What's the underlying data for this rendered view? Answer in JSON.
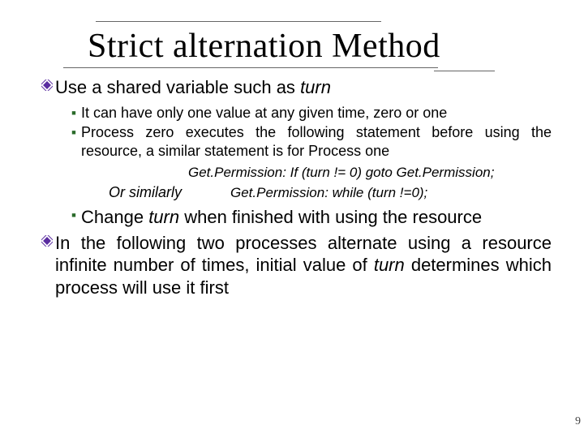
{
  "title": "Strict alternation Method",
  "b1": {
    "pre": "Use a shared variable such as ",
    "ital": "turn"
  },
  "b1_sub": {
    "s1": "It can have only one value at any given time, zero or one",
    "s2": "Process zero executes the following statement before using the resource, a similar statement is for Process one"
  },
  "code1": "Get.Permission: If (turn != 0) goto Get.Permission;",
  "or_label": "Or  similarly",
  "code2": "Get.Permission: while (turn !=0);",
  "b1_sub3": {
    "pre": "Change ",
    "ital": "turn",
    "post": " when finished with using the resource"
  },
  "b2": {
    "pre": "In the following two processes alternate using a resource infinite number of times, initial value of ",
    "ital": "turn",
    "post": " determines which process will use it first"
  },
  "pagenum": "9"
}
